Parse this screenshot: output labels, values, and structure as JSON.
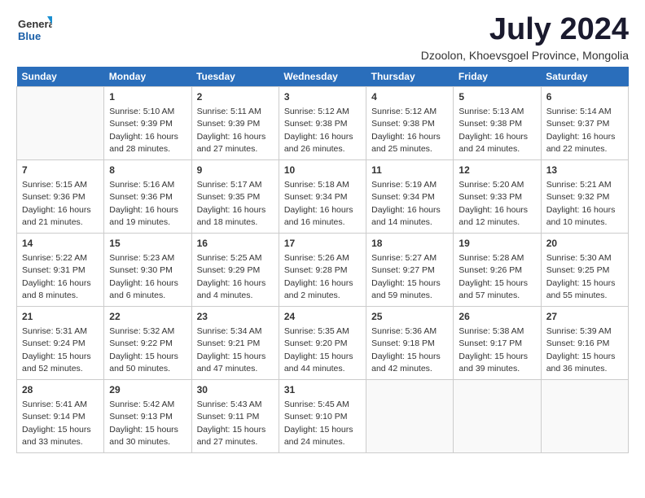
{
  "logo": {
    "general": "General",
    "blue": "Blue"
  },
  "title": "July 2024",
  "subtitle": "Dzoolon, Khoevsgoel Province, Mongolia",
  "headers": [
    "Sunday",
    "Monday",
    "Tuesday",
    "Wednesday",
    "Thursday",
    "Friday",
    "Saturday"
  ],
  "weeks": [
    [
      {
        "day": "",
        "info": ""
      },
      {
        "day": "1",
        "info": "Sunrise: 5:10 AM\nSunset: 9:39 PM\nDaylight: 16 hours\nand 28 minutes."
      },
      {
        "day": "2",
        "info": "Sunrise: 5:11 AM\nSunset: 9:39 PM\nDaylight: 16 hours\nand 27 minutes."
      },
      {
        "day": "3",
        "info": "Sunrise: 5:12 AM\nSunset: 9:38 PM\nDaylight: 16 hours\nand 26 minutes."
      },
      {
        "day": "4",
        "info": "Sunrise: 5:12 AM\nSunset: 9:38 PM\nDaylight: 16 hours\nand 25 minutes."
      },
      {
        "day": "5",
        "info": "Sunrise: 5:13 AM\nSunset: 9:38 PM\nDaylight: 16 hours\nand 24 minutes."
      },
      {
        "day": "6",
        "info": "Sunrise: 5:14 AM\nSunset: 9:37 PM\nDaylight: 16 hours\nand 22 minutes."
      }
    ],
    [
      {
        "day": "7",
        "info": "Sunrise: 5:15 AM\nSunset: 9:36 PM\nDaylight: 16 hours\nand 21 minutes."
      },
      {
        "day": "8",
        "info": "Sunrise: 5:16 AM\nSunset: 9:36 PM\nDaylight: 16 hours\nand 19 minutes."
      },
      {
        "day": "9",
        "info": "Sunrise: 5:17 AM\nSunset: 9:35 PM\nDaylight: 16 hours\nand 18 minutes."
      },
      {
        "day": "10",
        "info": "Sunrise: 5:18 AM\nSunset: 9:34 PM\nDaylight: 16 hours\nand 16 minutes."
      },
      {
        "day": "11",
        "info": "Sunrise: 5:19 AM\nSunset: 9:34 PM\nDaylight: 16 hours\nand 14 minutes."
      },
      {
        "day": "12",
        "info": "Sunrise: 5:20 AM\nSunset: 9:33 PM\nDaylight: 16 hours\nand 12 minutes."
      },
      {
        "day": "13",
        "info": "Sunrise: 5:21 AM\nSunset: 9:32 PM\nDaylight: 16 hours\nand 10 minutes."
      }
    ],
    [
      {
        "day": "14",
        "info": "Sunrise: 5:22 AM\nSunset: 9:31 PM\nDaylight: 16 hours\nand 8 minutes."
      },
      {
        "day": "15",
        "info": "Sunrise: 5:23 AM\nSunset: 9:30 PM\nDaylight: 16 hours\nand 6 minutes."
      },
      {
        "day": "16",
        "info": "Sunrise: 5:25 AM\nSunset: 9:29 PM\nDaylight: 16 hours\nand 4 minutes."
      },
      {
        "day": "17",
        "info": "Sunrise: 5:26 AM\nSunset: 9:28 PM\nDaylight: 16 hours\nand 2 minutes."
      },
      {
        "day": "18",
        "info": "Sunrise: 5:27 AM\nSunset: 9:27 PM\nDaylight: 15 hours\nand 59 minutes."
      },
      {
        "day": "19",
        "info": "Sunrise: 5:28 AM\nSunset: 9:26 PM\nDaylight: 15 hours\nand 57 minutes."
      },
      {
        "day": "20",
        "info": "Sunrise: 5:30 AM\nSunset: 9:25 PM\nDaylight: 15 hours\nand 55 minutes."
      }
    ],
    [
      {
        "day": "21",
        "info": "Sunrise: 5:31 AM\nSunset: 9:24 PM\nDaylight: 15 hours\nand 52 minutes."
      },
      {
        "day": "22",
        "info": "Sunrise: 5:32 AM\nSunset: 9:22 PM\nDaylight: 15 hours\nand 50 minutes."
      },
      {
        "day": "23",
        "info": "Sunrise: 5:34 AM\nSunset: 9:21 PM\nDaylight: 15 hours\nand 47 minutes."
      },
      {
        "day": "24",
        "info": "Sunrise: 5:35 AM\nSunset: 9:20 PM\nDaylight: 15 hours\nand 44 minutes."
      },
      {
        "day": "25",
        "info": "Sunrise: 5:36 AM\nSunset: 9:18 PM\nDaylight: 15 hours\nand 42 minutes."
      },
      {
        "day": "26",
        "info": "Sunrise: 5:38 AM\nSunset: 9:17 PM\nDaylight: 15 hours\nand 39 minutes."
      },
      {
        "day": "27",
        "info": "Sunrise: 5:39 AM\nSunset: 9:16 PM\nDaylight: 15 hours\nand 36 minutes."
      }
    ],
    [
      {
        "day": "28",
        "info": "Sunrise: 5:41 AM\nSunset: 9:14 PM\nDaylight: 15 hours\nand 33 minutes."
      },
      {
        "day": "29",
        "info": "Sunrise: 5:42 AM\nSunset: 9:13 PM\nDaylight: 15 hours\nand 30 minutes."
      },
      {
        "day": "30",
        "info": "Sunrise: 5:43 AM\nSunset: 9:11 PM\nDaylight: 15 hours\nand 27 minutes."
      },
      {
        "day": "31",
        "info": "Sunrise: 5:45 AM\nSunset: 9:10 PM\nDaylight: 15 hours\nand 24 minutes."
      },
      {
        "day": "",
        "info": ""
      },
      {
        "day": "",
        "info": ""
      },
      {
        "day": "",
        "info": ""
      }
    ]
  ]
}
